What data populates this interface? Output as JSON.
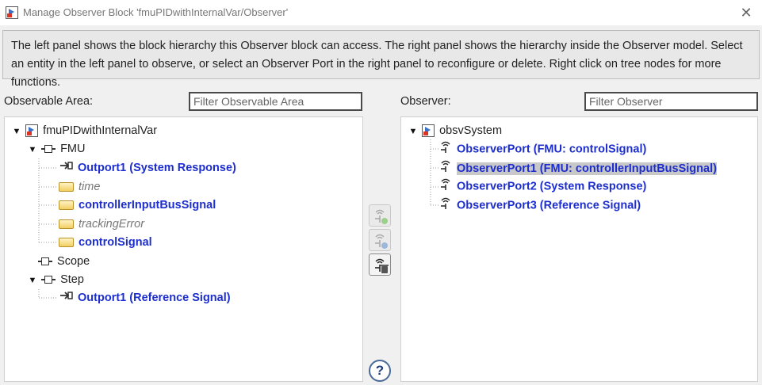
{
  "window": {
    "title": "Manage Observer Block 'fmuPIDwithInternalVar/Observer'"
  },
  "description": "The left panel shows the block hierarchy this Observer block can access. The right panel shows the hierarchy inside the Observer model. Select an entity in the left panel to observe, or select an Observer Port in the right panel to reconfigure or delete. Right click on tree nodes for more functions.",
  "observable": {
    "label": "Observable Area:",
    "filter_placeholder": "Filter Observable Area",
    "tree": {
      "root": "fmuPIDwithInternalVar",
      "fmu": "FMU",
      "fmu_outport": "Outport1 (System Response)",
      "fmu_time": "time",
      "fmu_controller_input": "controllerInputBusSignal",
      "fmu_tracking_error": "trackingError",
      "fmu_control_signal": "controlSignal",
      "scope": "Scope",
      "step": "Step",
      "step_outport": "Outport1 (Reference Signal)"
    }
  },
  "observer": {
    "label": "Observer:",
    "filter_placeholder": "Filter Observer",
    "tree": {
      "root": "obsvSystem",
      "port0": "ObserverPort (FMU: controlSignal)",
      "port1": "ObserverPort1 (FMU: controllerInputBusSignal)",
      "port2": "ObserverPort2 (System Response)",
      "port3": "ObserverPort3 (Reference Signal)"
    }
  },
  "actions": {
    "add_icon": "add-observer-port-icon",
    "reconfigure_icon": "reconfigure-port-icon",
    "delete_icon": "delete-port-icon",
    "help": "?"
  },
  "colors": {
    "accent_blue": "#1d2ecf",
    "selection": "#c8c8c8"
  }
}
